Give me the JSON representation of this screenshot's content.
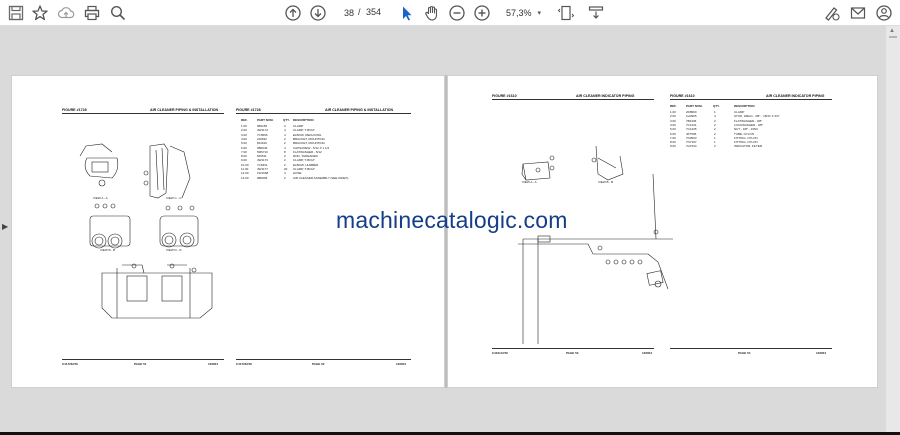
{
  "toolbar": {
    "save_icon": "save-icon",
    "bookmark_icon": "star-icon",
    "upload_icon": "cloud-upload-icon",
    "print_icon": "print-icon",
    "zoom_icon": "magnifier-icon",
    "current_page": "38",
    "page_sep": "/",
    "total_pages": "354",
    "zoom_level": "57,3%",
    "zoom_chevron": "▾"
  },
  "pages": {
    "left": {
      "figure_a": "FIGURE #1728",
      "title_a": "AIR CLEANER PIPING & INSTALLATION",
      "figure_b": "FIGURE #1728",
      "title_b": "AIR CLEANER PIPING & INSTALLATION",
      "col_ref": "REF.",
      "col_part": "PART NUM.",
      "col_qty": "QTY.",
      "col_desc": "DESCRIPTION",
      "rows": [
        [
          "1.00",
          "9B1156",
          "3",
          "CLAMP"
        ],
        [
          "2.00",
          "4W1173",
          "4",
          "CLAMP, T-BOLT"
        ],
        [
          "3.00",
          "7C5696",
          "4",
          "ELBOW, REDUCING"
        ],
        [
          "4.00",
          "2J9632",
          "2",
          "BRACKET, MOUNTING"
        ],
        [
          "5.00",
          "8J4619",
          "2",
          "BRACKET, MOUNTING"
        ],
        [
          "6.00",
          "0B0046",
          "4",
          "CAPSCREW - 5/12 X 1 1/2"
        ],
        [
          "7.00",
          "5M6710",
          "8",
          "FLATWASHER - 5/12"
        ],
        [
          "8.00",
          "8J9511",
          "2",
          "ROD, THREADED"
        ],
        [
          "9.00",
          "4W1173",
          "2",
          "CLAMP, T-BOLT"
        ],
        [
          "10.00",
          "7C6331",
          "2",
          "ELBOW, HUMBER"
        ],
        [
          "11.00",
          "4W1177",
          "20",
          "CLAMP, T-BOLT"
        ],
        [
          "12.00",
          "1W1668",
          "4",
          "HOSE"
        ],
        [
          "13.00",
          "9B0096",
          "2",
          "AIR CLEANER ASSEMBLY (SEE INDEX)"
        ]
      ],
      "view_a": "VIEW A - A",
      "view_c": "VIEW C - C",
      "view_b": "VIEW B - B",
      "view_d": "VIEW D - D",
      "footer_file_a": "C41728.FM",
      "footer_page_a": "PAGE 51",
      "footer_date_a": "12/8/04",
      "footer_file_b": "C41728.FM",
      "footer_page_b": "PAGE 52",
      "footer_date_b": "12/8/04"
    },
    "right": {
      "figure_a": "FIGURE #1610",
      "title_a": "AIR CLEANER INDICATOR PIPING",
      "figure_b": "FIGURE #1610",
      "title_b": "AIR CLEANER INDICATOR PIPING",
      "col_ref": "REF.",
      "col_part": "PART NUM.",
      "col_qty": "QTY.",
      "col_desc": "DESCRIPTION",
      "rows": [
        [
          "1.00",
          "2D8969",
          "1",
          "CLAMP"
        ],
        [
          "2.00",
          "1H4965",
          "4",
          "STUD, WELD - 3/8\" - 16NC X 3/4\""
        ],
        [
          "3.00",
          "7B4436",
          "2",
          "FLATWASHER - 3/8\""
        ],
        [
          "4.00",
          "7C1231",
          "2",
          "LOCKWASHER - 3/8\""
        ],
        [
          "5.00",
          "7C1235",
          "2",
          "NUT - 3/8\" - 16NC"
        ],
        [
          "6.00",
          "4K7505",
          "2",
          "TUBE, NYLON"
        ],
        [
          "7.00",
          "7N3503",
          "1",
          "FITTING, NYLON"
        ],
        [
          "8.00",
          "7N7197",
          "1",
          "FITTING, NYLON"
        ],
        [
          "9.00",
          "7H7234",
          "2",
          "INDICATOR, FILTER"
        ]
      ],
      "view_a": "VIEW A - A",
      "view_b": "VIEW B - B",
      "footer_file_a": "C41610.FM",
      "footer_page_a": "PAGE 53",
      "footer_date_a": "12/8/04",
      "footer_page_b": "PAGE 54",
      "footer_date_b": "12/8/04"
    }
  },
  "watermark": "machinecatalogic.com",
  "colors": {
    "watermark": "#153d8a",
    "doc_bg": "#dadada",
    "accent": "#1a63c9"
  }
}
